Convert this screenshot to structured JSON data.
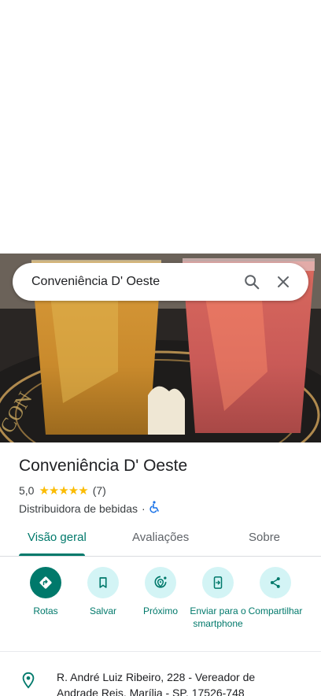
{
  "search": {
    "query": "Conveniência D' Oeste"
  },
  "place": {
    "name": "Conveniência D' Oeste",
    "rating": "5,0",
    "stars": "★★★★★",
    "reviews": "(7)",
    "category": "Distribuidora de bebidas",
    "separator": "·"
  },
  "tabs": [
    {
      "label": "Visão geral"
    },
    {
      "label": "Avaliações"
    },
    {
      "label": "Sobre"
    }
  ],
  "actions": [
    {
      "label": "Rotas",
      "icon": "directions-icon"
    },
    {
      "label": "Salvar",
      "icon": "bookmark-icon"
    },
    {
      "label": "Próximo",
      "icon": "nearby-icon"
    },
    {
      "label": "Enviar para o smartphone",
      "icon": "send-to-phone-icon"
    },
    {
      "label": "Compartilhar",
      "icon": "share-icon"
    }
  ],
  "address": {
    "text": "R. André Luiz Ribeiro, 228 - Vereador de Andrade Reis, Marília - SP, 17526-748"
  },
  "colors": {
    "accent": "#00796b",
    "accent_light": "#d3f4f5",
    "star": "#fbbc04",
    "wheelchair": "#1a73e8"
  }
}
